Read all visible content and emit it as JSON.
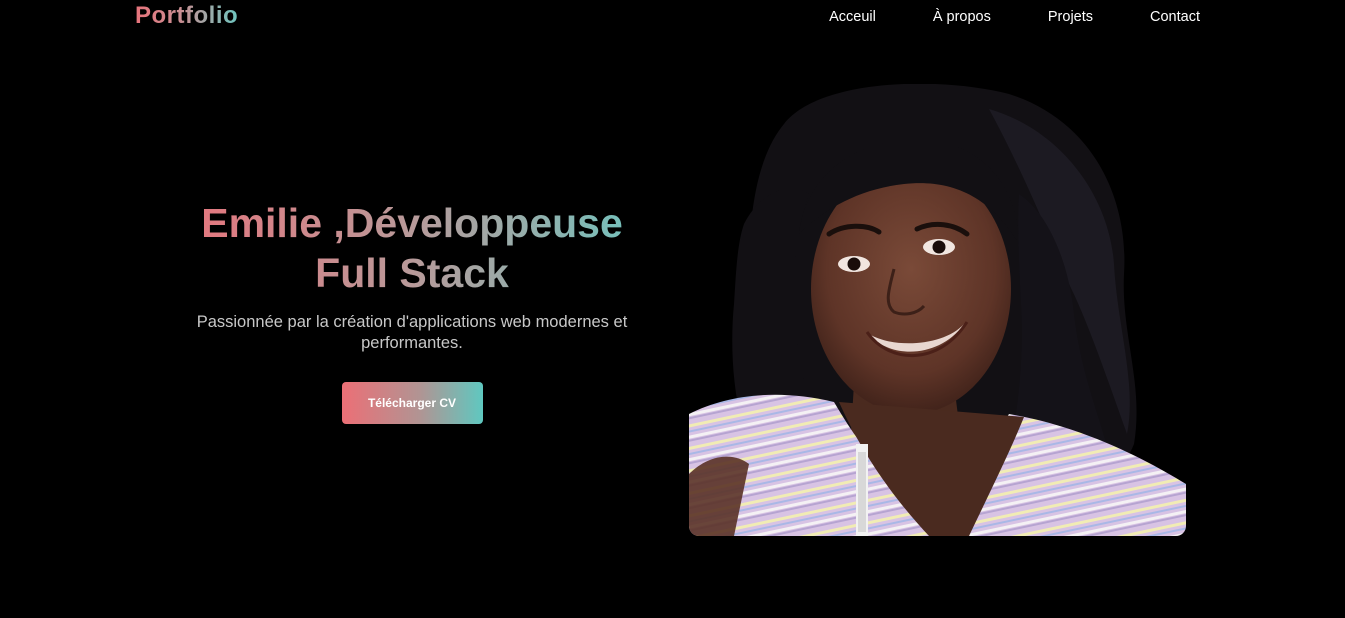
{
  "header": {
    "logo": "Portfolio",
    "nav": [
      {
        "label": "Acceuil"
      },
      {
        "label": "À propos"
      },
      {
        "label": "Projets"
      },
      {
        "label": "Contact"
      }
    ]
  },
  "hero": {
    "title_line1": "Emilie ,Développeuse",
    "title_line2": "Full Stack",
    "subtitle": "Passionnée par la création d'applications web modernes et performantes.",
    "cv_button": "Télécharger CV"
  },
  "colors": {
    "background": "#000000",
    "gradient_start": "#e8747c",
    "gradient_end": "#6ec5bf",
    "nav_text": "#ffffff",
    "subtitle_text": "#c8c8c8"
  }
}
